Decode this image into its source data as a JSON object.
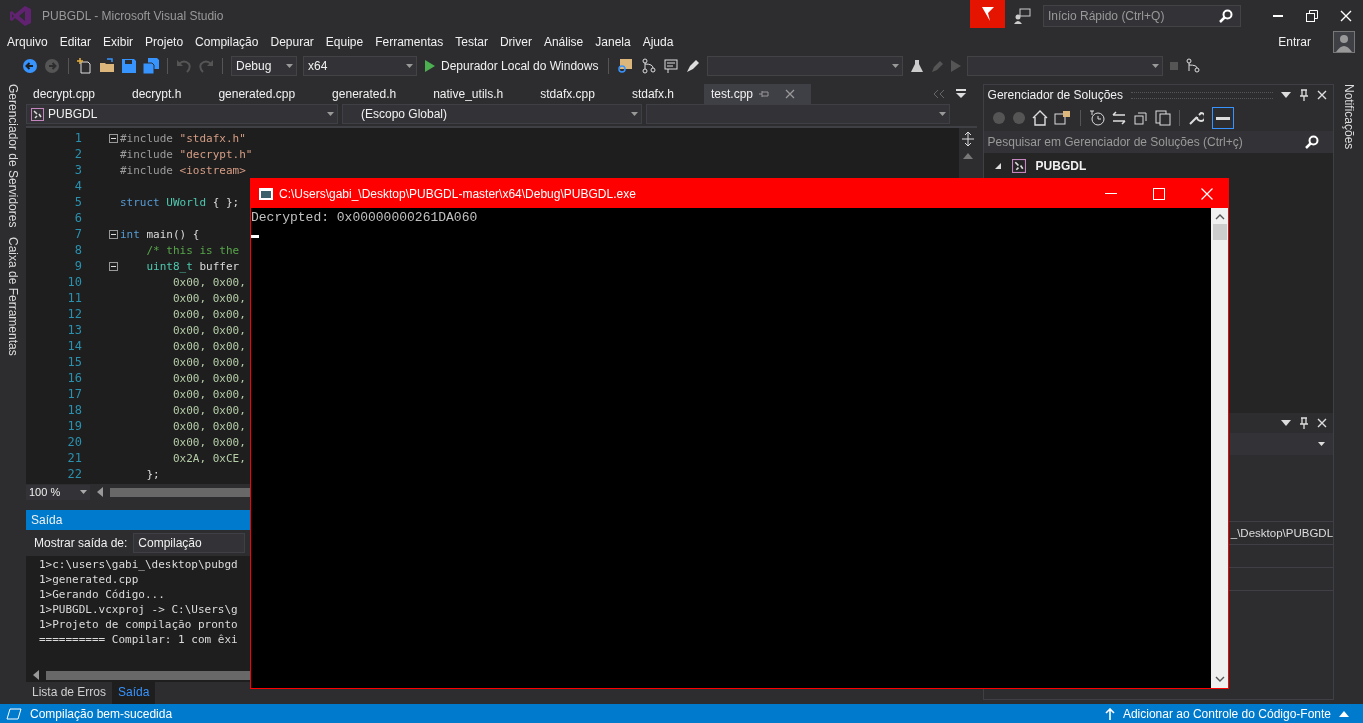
{
  "window": {
    "title": "PUBGDL - Microsoft Visual Studio"
  },
  "quick_launch": {
    "placeholder": "Início Rápido (Ctrl+Q)"
  },
  "menu": [
    "Arquivo",
    "Editar",
    "Exibir",
    "Projeto",
    "Compilação",
    "Depurar",
    "Equipe",
    "Ferramentas",
    "Testar",
    "Driver",
    "Análise",
    "Janela",
    "Ajuda"
  ],
  "account": {
    "label": "Entrar"
  },
  "toolbar": {
    "configuration": "Debug",
    "platform": "x64",
    "debugger": "Depurador Local do Windows"
  },
  "side_tabs_left": [
    "Gerenciador de Servidores",
    "Caixa de Ferramentas"
  ],
  "side_tabs_right": [
    "Notificações"
  ],
  "editor": {
    "tabs": [
      {
        "label": "decrypt.cpp",
        "selected": false
      },
      {
        "label": "decrypt.h",
        "selected": false
      },
      {
        "label": "generated.cpp",
        "selected": false
      },
      {
        "label": "generated.h",
        "selected": false
      },
      {
        "label": "native_utils.h",
        "selected": false
      },
      {
        "label": "stdafx.cpp",
        "selected": false
      },
      {
        "label": "stdafx.h",
        "selected": false
      },
      {
        "label": "test.cpp",
        "selected": true
      }
    ],
    "nav": {
      "project": "PUBGDL",
      "scope": "(Escopo Global)"
    },
    "lines": [
      {
        "number": "1",
        "fold": true,
        "segments": [
          {
            "text": "#include",
            "kind": "preproc"
          },
          {
            "text": " \"stdafx.h\"",
            "kind": "string"
          }
        ]
      },
      {
        "number": "2",
        "fold": false,
        "segments": [
          {
            "text": "#include",
            "kind": "preproc"
          },
          {
            "text": " \"decrypt.h\"",
            "kind": "string"
          }
        ]
      },
      {
        "number": "3",
        "fold": false,
        "segments": [
          {
            "text": "#include",
            "kind": "preproc"
          },
          {
            "text": " <iostream>",
            "kind": "string"
          }
        ]
      },
      {
        "number": "4",
        "fold": false
      },
      {
        "number": "5",
        "fold": false,
        "segments": [
          {
            "text": "struct",
            "kind": "keyword"
          },
          {
            "text": " UWorld",
            "kind": "type"
          },
          {
            "text": " { };",
            "kind": "plain"
          }
        ]
      },
      {
        "number": "6",
        "fold": false
      },
      {
        "number": "7",
        "fold": true,
        "segments": [
          {
            "text": "int",
            "kind": "keyword"
          },
          {
            "text": " main() {",
            "kind": "plain"
          }
        ]
      },
      {
        "number": "8",
        "fold": false,
        "segments": [
          {
            "text": "    /* this is the",
            "kind": "comment"
          }
        ]
      },
      {
        "number": "9",
        "fold": true,
        "segments": [
          {
            "text": "    uint8_t",
            "kind": "type"
          },
          {
            "text": " buffer",
            "kind": "plain"
          }
        ]
      },
      {
        "number": "10",
        "fold": false,
        "segments": [
          {
            "text": "        0x00, 0x00,",
            "kind": "number"
          }
        ]
      },
      {
        "number": "11",
        "fold": false,
        "segments": [
          {
            "text": "        0x00, 0x00,",
            "kind": "number"
          }
        ]
      },
      {
        "number": "12",
        "fold": false,
        "segments": [
          {
            "text": "        0x00, 0x00,",
            "kind": "number"
          }
        ]
      },
      {
        "number": "13",
        "fold": false,
        "segments": [
          {
            "text": "        0x00, 0x00,",
            "kind": "number"
          }
        ]
      },
      {
        "number": "14",
        "fold": false,
        "segments": [
          {
            "text": "        0x00, 0x00,",
            "kind": "number"
          }
        ]
      },
      {
        "number": "15",
        "fold": false,
        "segments": [
          {
            "text": "        0x00, 0x00,",
            "kind": "number"
          }
        ]
      },
      {
        "number": "16",
        "fold": false,
        "segments": [
          {
            "text": "        0x00, 0x00,",
            "kind": "number"
          }
        ]
      },
      {
        "number": "17",
        "fold": false,
        "segments": [
          {
            "text": "        0x00, 0x00,",
            "kind": "number"
          }
        ]
      },
      {
        "number": "18",
        "fold": false,
        "segments": [
          {
            "text": "        0x00, 0x00,",
            "kind": "number"
          }
        ]
      },
      {
        "number": "19",
        "fold": false,
        "segments": [
          {
            "text": "        0x00, 0x00,",
            "kind": "number"
          }
        ]
      },
      {
        "number": "20",
        "fold": false,
        "segments": [
          {
            "text": "        0x00, 0x00,",
            "kind": "number"
          }
        ]
      },
      {
        "number": "21",
        "fold": false,
        "segments": [
          {
            "text": "        0x2A, 0xCE,",
            "kind": "number"
          }
        ]
      },
      {
        "number": "22",
        "fold": false,
        "segments": [
          {
            "text": "    };",
            "kind": "plain"
          }
        ]
      }
    ],
    "zoom": "100 %"
  },
  "output": {
    "title": "Saída",
    "source_label": "Mostrar saída de:",
    "source": "Compilação",
    "lines": [
      "1>c:\\users\\gabi_\\desktop\\pubgd",
      "1>generated.cpp",
      "1>Gerando Código...",
      "1>PUBGDL.vcxproj -> C:\\Users\\g",
      "1>Projeto de compilação pronto",
      "========== Compilar: 1 com êxi"
    ]
  },
  "bottom_tabs": [
    {
      "label": "Lista de Erros",
      "selected": false
    },
    {
      "label": "Saída",
      "selected": true
    }
  ],
  "solution_explorer": {
    "title": "Gerenciador de Soluções",
    "search": {
      "placeholder": "Pesquisar em Gerenciador de Soluções (Ctrl+ç)"
    },
    "tree": [
      {
        "label": "PUBGDL",
        "expanded": true
      }
    ]
  },
  "properties": {
    "row_text": "_\\Desktop\\PUBGDL"
  },
  "status_bar": {
    "message": "Compilação bem-sucedida",
    "action": "Adicionar ao Controle do Código-Fonte"
  },
  "console": {
    "title": "C:\\Users\\gabi_\\Desktop\\PUBGDL-master\\x64\\Debug\\PUBGDL.exe",
    "lines": [
      "Decrypted: 0x00000000261DA060"
    ]
  }
}
